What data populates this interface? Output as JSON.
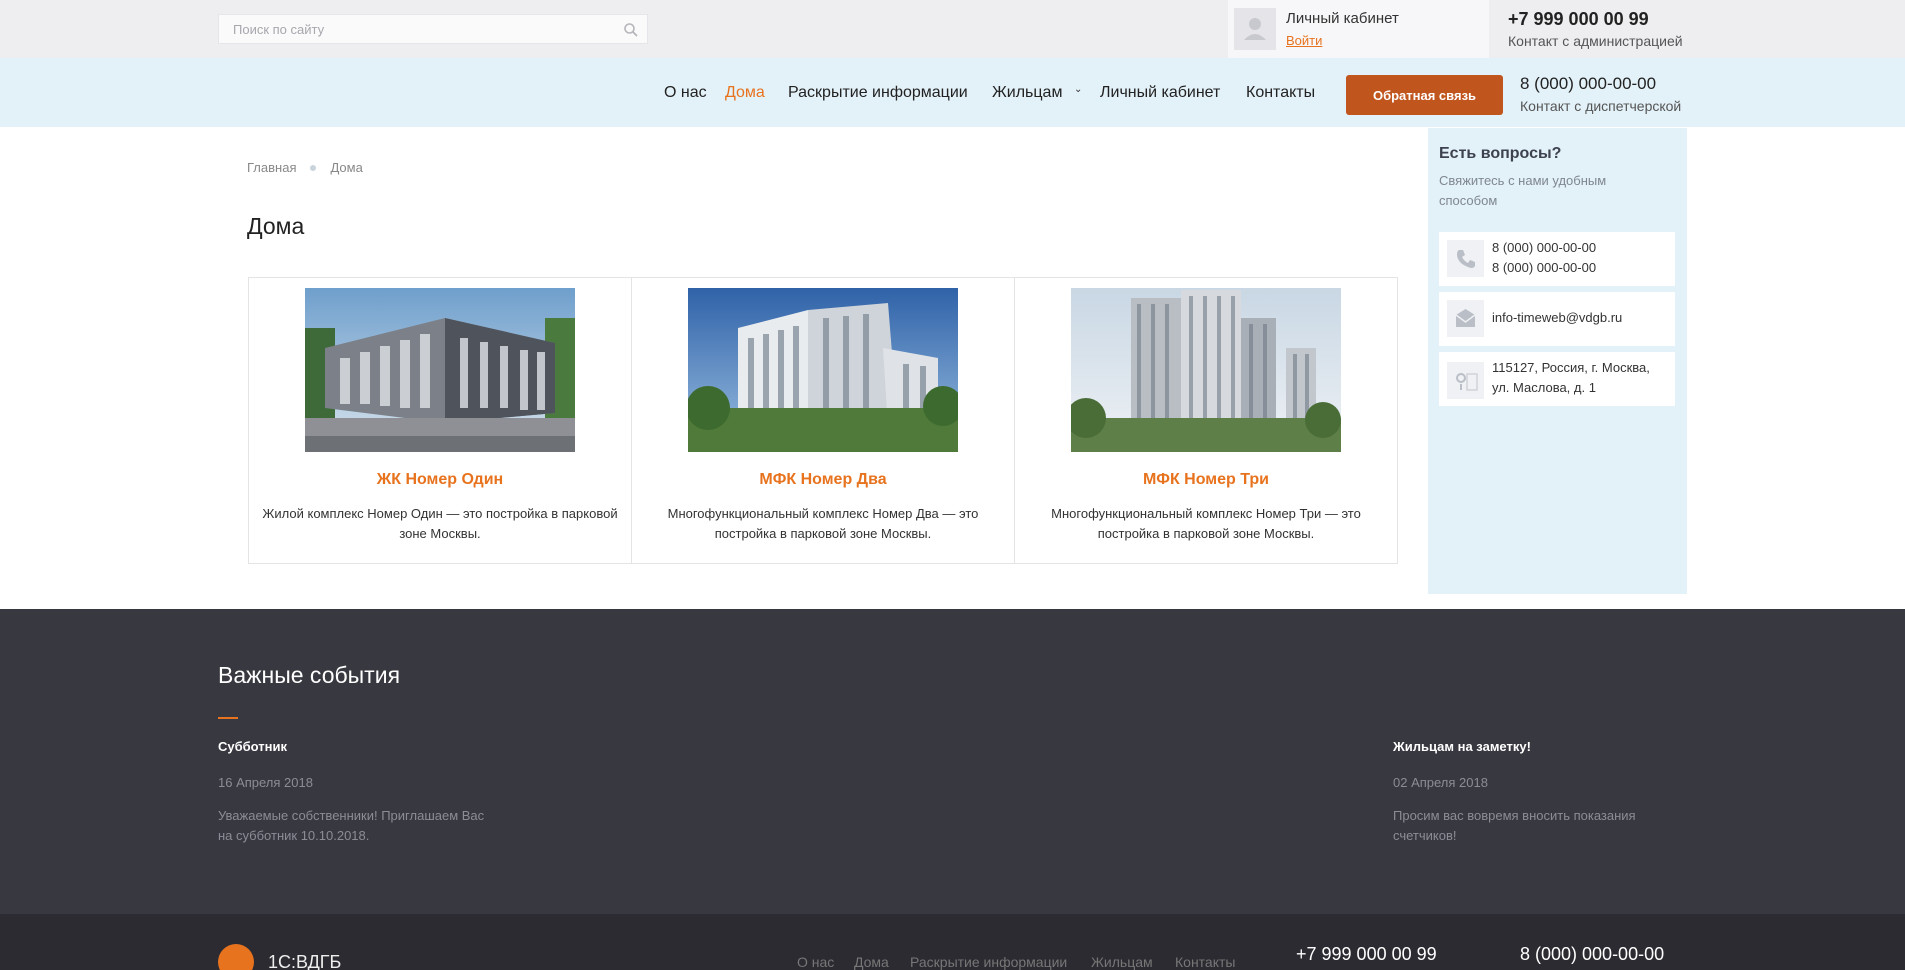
{
  "topbar": {
    "search_placeholder": "Поиск по сайту",
    "cabinet_label": "Личный кабинет",
    "login_link": "Войти",
    "phone": "+7 999 000 00 99",
    "phone_caption": "Контакт с администрацией"
  },
  "nav": {
    "items": [
      "О нас",
      "Дома",
      "Раскрытие информации",
      "Жильцам",
      "Личный кабинет",
      "Контакты"
    ],
    "active": "Дома",
    "callback_label": "Обратная связь",
    "phone": "8 (000) 000-00-00",
    "phone_caption": "Контакт с диспетчерской"
  },
  "breadcrumb": [
    "Главная",
    "Дома"
  ],
  "page_title": "Дома",
  "houses": [
    {
      "title": "ЖК Номер Один",
      "desc": "Жилой комплекс Номер Один — это постройка в парковой зоне Москвы."
    },
    {
      "title": "МФК Номер Два",
      "desc": "Многофункциональный комплекс Номер Два — это постройка в парковой зоне Москвы."
    },
    {
      "title": "МФК Номер Три",
      "desc": "Многофункциональный комплекс Номер Три — это постройка в парковой зоне Москвы."
    }
  ],
  "sidebar": {
    "heading": "Есть вопросы?",
    "subtitle": "Свяжитесь с нами удобным способом",
    "phone1": "8 (000) 000-00-00",
    "phone2": "8 (000) 000-00-00",
    "email": "info-timeweb@vdgb.ru",
    "address_line1": "115127, Россия, г. Москва,",
    "address_line2": "ул. Маслова, д. 1"
  },
  "events": {
    "title": "Важные события",
    "items": [
      {
        "name": "Субботник",
        "date": "16 Апреля 2018",
        "text": "Уважаемые собственники! Приглашаем Вас на субботник 10.10.2018."
      },
      {
        "name": "Жильцам на заметку!",
        "date": "02 Апреля 2018",
        "text": "Просим вас вовремя вносить показания счетчиков!"
      }
    ]
  },
  "footer": {
    "brand": "1С:ВДГБ",
    "links": [
      "О нас",
      "Дома",
      "Раскрытие информации",
      "Жильцам",
      "Контакты"
    ],
    "phone1": "+7 999 000 00 99",
    "phone2": "8 (000) 000-00-00"
  },
  "colors": {
    "accent": "#e8731e",
    "button": "#c0551d",
    "nav_bg": "#e3f1f8",
    "events_bg": "#383840"
  }
}
